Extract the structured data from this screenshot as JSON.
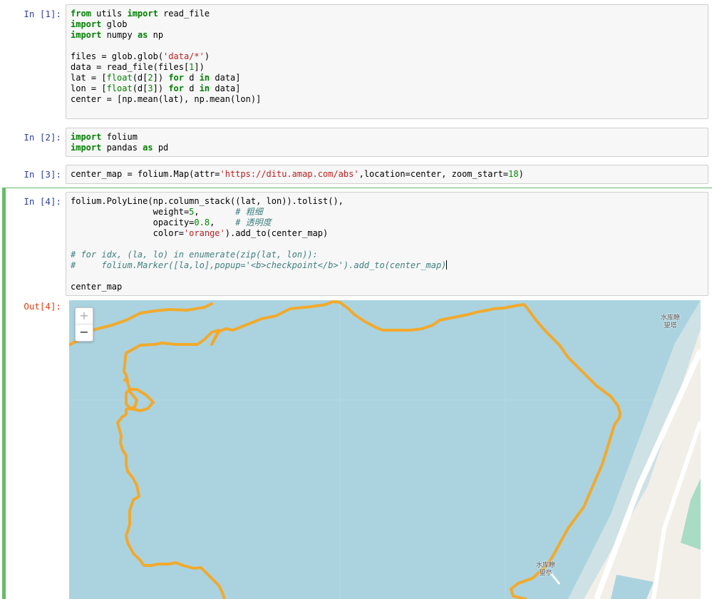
{
  "cells": [
    {
      "prompt": "In  [1]:",
      "lines": [
        [
          [
            "kw",
            "from"
          ],
          [
            "t",
            " utils "
          ],
          [
            "kw",
            "import"
          ],
          [
            "t",
            " read_file"
          ]
        ],
        [
          [
            "kw",
            "import"
          ],
          [
            "t",
            " glob"
          ]
        ],
        [
          [
            "kw",
            "import"
          ],
          [
            "t",
            " numpy "
          ],
          [
            "kw",
            "as"
          ],
          [
            "t",
            " np"
          ]
        ],
        [],
        [
          [
            "t",
            "files = glob.glob("
          ],
          [
            "str",
            "'data/*'"
          ],
          [
            "t",
            ")"
          ]
        ],
        [
          [
            "t",
            "data = read_file(files["
          ],
          [
            "num",
            "1"
          ],
          [
            "t",
            "])"
          ]
        ],
        [
          [
            "t",
            "lat = ["
          ],
          [
            "bi",
            "float"
          ],
          [
            "t",
            "(d["
          ],
          [
            "num",
            "2"
          ],
          [
            "t",
            "]) "
          ],
          [
            "kw",
            "for"
          ],
          [
            "t",
            " d "
          ],
          [
            "kw",
            "in"
          ],
          [
            "t",
            " data]"
          ]
        ],
        [
          [
            "t",
            "lon = ["
          ],
          [
            "bi",
            "float"
          ],
          [
            "t",
            "(d["
          ],
          [
            "num",
            "3"
          ],
          [
            "t",
            "]) "
          ],
          [
            "kw",
            "for"
          ],
          [
            "t",
            " d "
          ],
          [
            "kw",
            "in"
          ],
          [
            "t",
            " data]"
          ]
        ],
        [
          [
            "t",
            "center = [np.mean(lat), np.mean(lon)]"
          ]
        ],
        []
      ]
    },
    {
      "prompt": "In  [2]:",
      "lines": [
        [
          [
            "kw",
            "import"
          ],
          [
            "t",
            " folium"
          ]
        ],
        [
          [
            "kw",
            "import"
          ],
          [
            "t",
            " pandas "
          ],
          [
            "kw",
            "as"
          ],
          [
            "t",
            " pd"
          ]
        ]
      ]
    },
    {
      "prompt": "In  [3]:",
      "lines": [
        [
          [
            "t",
            "center_map = folium.Map(attr="
          ],
          [
            "str",
            "'https://ditu.amap.com/abs'"
          ],
          [
            "t",
            ",location=center, zoom_start="
          ],
          [
            "num",
            "18"
          ],
          [
            "t",
            ")"
          ]
        ]
      ]
    },
    {
      "prompt": "In  [4]:",
      "lines": [
        [
          [
            "t",
            "folium.PolyLine(np.column_stack((lat, lon)).tolist(),"
          ]
        ],
        [
          [
            "t",
            "                weight="
          ],
          [
            "num",
            "5"
          ],
          [
            "t",
            ",       "
          ],
          [
            "cm",
            "# 粗细"
          ]
        ],
        [
          [
            "t",
            "                opacity="
          ],
          [
            "num",
            "0.8"
          ],
          [
            "t",
            ",    "
          ],
          [
            "cm",
            "# 透明度"
          ]
        ],
        [
          [
            "t",
            "                color="
          ],
          [
            "str",
            "'orange'"
          ],
          [
            "t",
            ").add_to(center_map)"
          ]
        ],
        [],
        [
          [
            "cm",
            "# for idx, (la, lo) in enumerate(zip(lat, lon)):"
          ]
        ],
        [
          [
            "cm",
            "#     folium.Marker([la,lo],popup='<b>checkpoint</b>').add_to(center_map)"
          ]
        ],
        [],
        [
          [
            "t",
            "center_map"
          ]
        ]
      ]
    }
  ],
  "output": {
    "prompt": "Out[4]:",
    "map": {
      "zoom_in": "+",
      "zoom_out": "−",
      "water_color": "#aad3df",
      "land_color": "#f2efe9",
      "route_color": "#f5a623",
      "labels": [
        {
          "id": "tower-ne",
          "text": "水库瞭\n望塔"
        },
        {
          "id": "pavilion",
          "text": "水库瞭\n望亭"
        }
      ]
    }
  }
}
